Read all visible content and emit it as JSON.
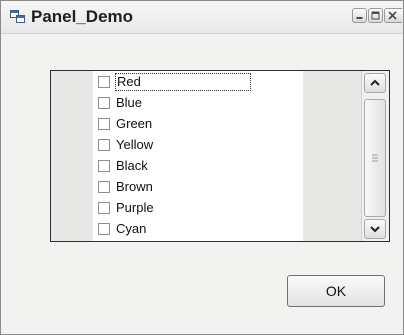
{
  "window": {
    "title": "Panel_Demo",
    "controls": [
      "minimize-icon",
      "maximize-icon",
      "close-icon"
    ]
  },
  "checklist": {
    "items": [
      {
        "label": "Red",
        "checked": false,
        "focused": true
      },
      {
        "label": "Blue",
        "checked": false
      },
      {
        "label": "Green",
        "checked": false
      },
      {
        "label": "Yellow",
        "checked": false
      },
      {
        "label": "Black",
        "checked": false
      },
      {
        "label": "Brown",
        "checked": false
      },
      {
        "label": "Purple",
        "checked": false
      },
      {
        "label": "Cyan",
        "checked": false
      }
    ]
  },
  "ok_button": {
    "label": "OK"
  }
}
